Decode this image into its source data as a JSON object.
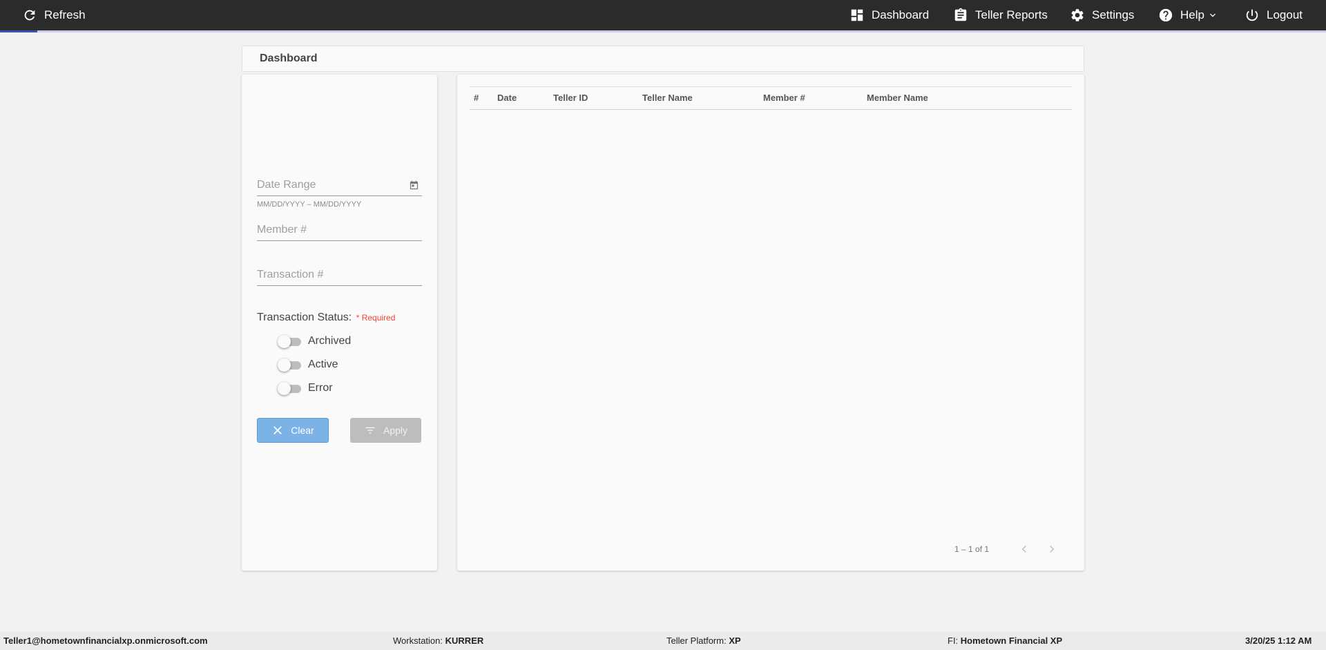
{
  "topbar": {
    "refresh_label": "Refresh",
    "dashboard_label": "Dashboard",
    "teller_reports_label": "Teller Reports",
    "settings_label": "Settings",
    "help_label": "Help",
    "logout_label": "Logout"
  },
  "page": {
    "title": "Dashboard"
  },
  "filters": {
    "date_range_placeholder": "Date Range",
    "date_range_hint": "MM/DD/YYYY – MM/DD/YYYY",
    "member_placeholder": "Member #",
    "transaction_placeholder": "Transaction #",
    "status_label": "Transaction Status:",
    "required_label": "* Required",
    "toggles": [
      {
        "label": "Archived",
        "checked": false
      },
      {
        "label": "Active",
        "checked": false
      },
      {
        "label": "Error",
        "checked": false
      }
    ],
    "clear_label": "Clear",
    "apply_label": "Apply"
  },
  "table": {
    "columns": [
      "#",
      "Date",
      "Teller ID",
      "Teller Name",
      "Member #",
      "Member Name"
    ],
    "rows": [],
    "range_label": "1 – 1 of 1"
  },
  "statusbar": {
    "user": "Teller1@hometownfinancialxp.onmicrosoft.com",
    "workstation_label": "Workstation:",
    "workstation_value": "KURRER",
    "platform_label": "Teller Platform:",
    "platform_value": "XP",
    "fi_label": "FI:",
    "fi_value": "Hometown Financial XP",
    "datetime": "3/20/25 1:12 AM"
  },
  "colors": {
    "topbar_bg": "#2b2b2b",
    "accent": "#3f51b5",
    "clear_button": "#7cb3e6",
    "required": "#f44336"
  }
}
